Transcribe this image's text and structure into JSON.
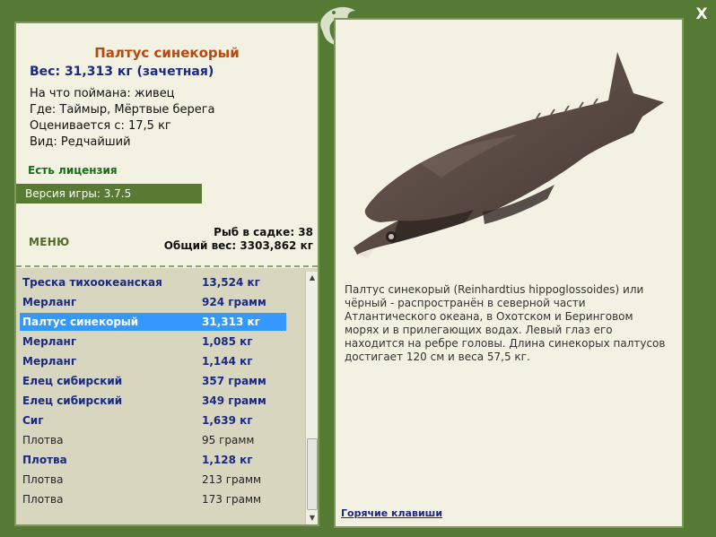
{
  "close_label": "X",
  "fish": {
    "title": "Палтус синекорый",
    "weight": "Вес: 31,313 кг (зачетная)",
    "caught_on": "На что поймана: живец",
    "location": "Где: Таймыр, Мёртвые берега",
    "valued_from": "Оценивается с: 17,5 кг",
    "kind": "Вид: Редчайший"
  },
  "license": "Есть лицензия",
  "version": "Версия игры: 3.7.5",
  "menu_label": "МЕНЮ",
  "stats": {
    "fish_count": "Рыб в садке: 38",
    "total_weight": "Общий вес: 3303,862 кг"
  },
  "catch_list": [
    {
      "name": "Треска тихоокеанская",
      "weight": "13,524 кг",
      "style": "bold"
    },
    {
      "name": "Мерланг",
      "weight": "924 грамм",
      "style": "bold"
    },
    {
      "name": "Палтус синекорый",
      "weight": "31,313 кг",
      "style": "selected"
    },
    {
      "name": "Мерланг",
      "weight": "1,085 кг",
      "style": "bold"
    },
    {
      "name": "Мерланг",
      "weight": "1,144 кг",
      "style": "bold"
    },
    {
      "name": "Елец сибирский",
      "weight": "357 грамм",
      "style": "bold"
    },
    {
      "name": "Елец сибирский",
      "weight": "349 грамм",
      "style": "bold"
    },
    {
      "name": "Сиг",
      "weight": "1,639 кг",
      "style": "bold"
    },
    {
      "name": "Плотва",
      "weight": "95 грамм",
      "style": "normal"
    },
    {
      "name": "Плотва",
      "weight": "1,128 кг",
      "style": "bold"
    },
    {
      "name": "Плотва",
      "weight": "213 грамм",
      "style": "normal"
    },
    {
      "name": "Плотва",
      "weight": "173 грамм",
      "style": "normal"
    }
  ],
  "description": "Палтус синекорый (Reinhardtius hippoglossoides) или чёрный - распространён в северной части Атлантического океана, в Охотском и Беринговом морях и в прилегающих водах. Левый глаз его находится на ребре головы. Длина синекорых палтусов достигает 120 см и веса 57,5 кг.",
  "hotkeys_label": "Горячие клавиши",
  "colors": {
    "frame": "#557a33",
    "panel": "#f3f1e1",
    "list_bg": "#d8d6bf",
    "selected": "#3399ff",
    "title": "#b84a10",
    "bold_text": "#1a2a80"
  }
}
